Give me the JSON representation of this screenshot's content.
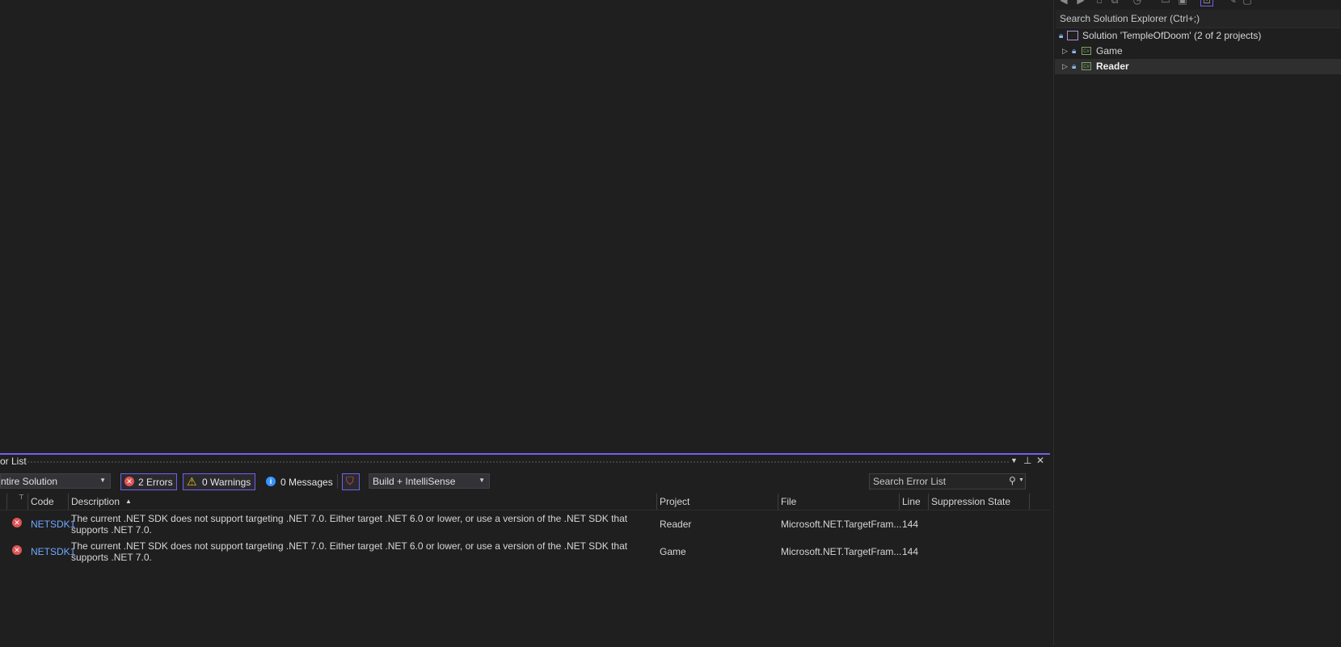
{
  "solution_explorer": {
    "search_placeholder": "Search Solution Explorer (Ctrl+;)",
    "solution_label": "Solution 'TempleOfDoom' (2 of 2 projects)",
    "projects": [
      {
        "name": "Game",
        "icon": "csharp-project-icon"
      },
      {
        "name": "Reader",
        "icon": "csharp-project-icon"
      }
    ],
    "project_icon_text": "C#"
  },
  "error_list": {
    "title": "or List",
    "scope": "ntire Solution",
    "errors_label": "2 Errors",
    "warnings_label": "0 Warnings",
    "messages_label": "0 Messages",
    "build_filter": "Build + IntelliSense",
    "search_placeholder": "Search Error List",
    "columns": {
      "code": "Code",
      "description": "Description",
      "project": "Project",
      "file": "File",
      "line": "Line",
      "suppression": "Suppression State"
    },
    "rows": [
      {
        "code": "NETSDK1",
        "description_1": "The current .NET SDK does not support targeting .NET 7.0.  Either target .NET 6.0 or lower, or use a version of the .NET SDK that",
        "description_2": "supports .NET 7.0.",
        "project": "Reader",
        "file": "Microsoft.NET.TargetFram...",
        "line": "144"
      },
      {
        "code": "NETSDK1",
        "description_1": "The current .NET SDK does not support targeting .NET 7.0.  Either target .NET 6.0 or lower, or use a version of the .NET SDK that",
        "description_2": "supports .NET 7.0.",
        "project": "Game",
        "file": "Microsoft.NET.TargetFram...",
        "line": "144"
      }
    ]
  },
  "colors": {
    "accent": "#7160e8",
    "error": "#e05555",
    "warning": "#f1c40f",
    "info": "#3794ff",
    "link": "#6fa8ff"
  }
}
